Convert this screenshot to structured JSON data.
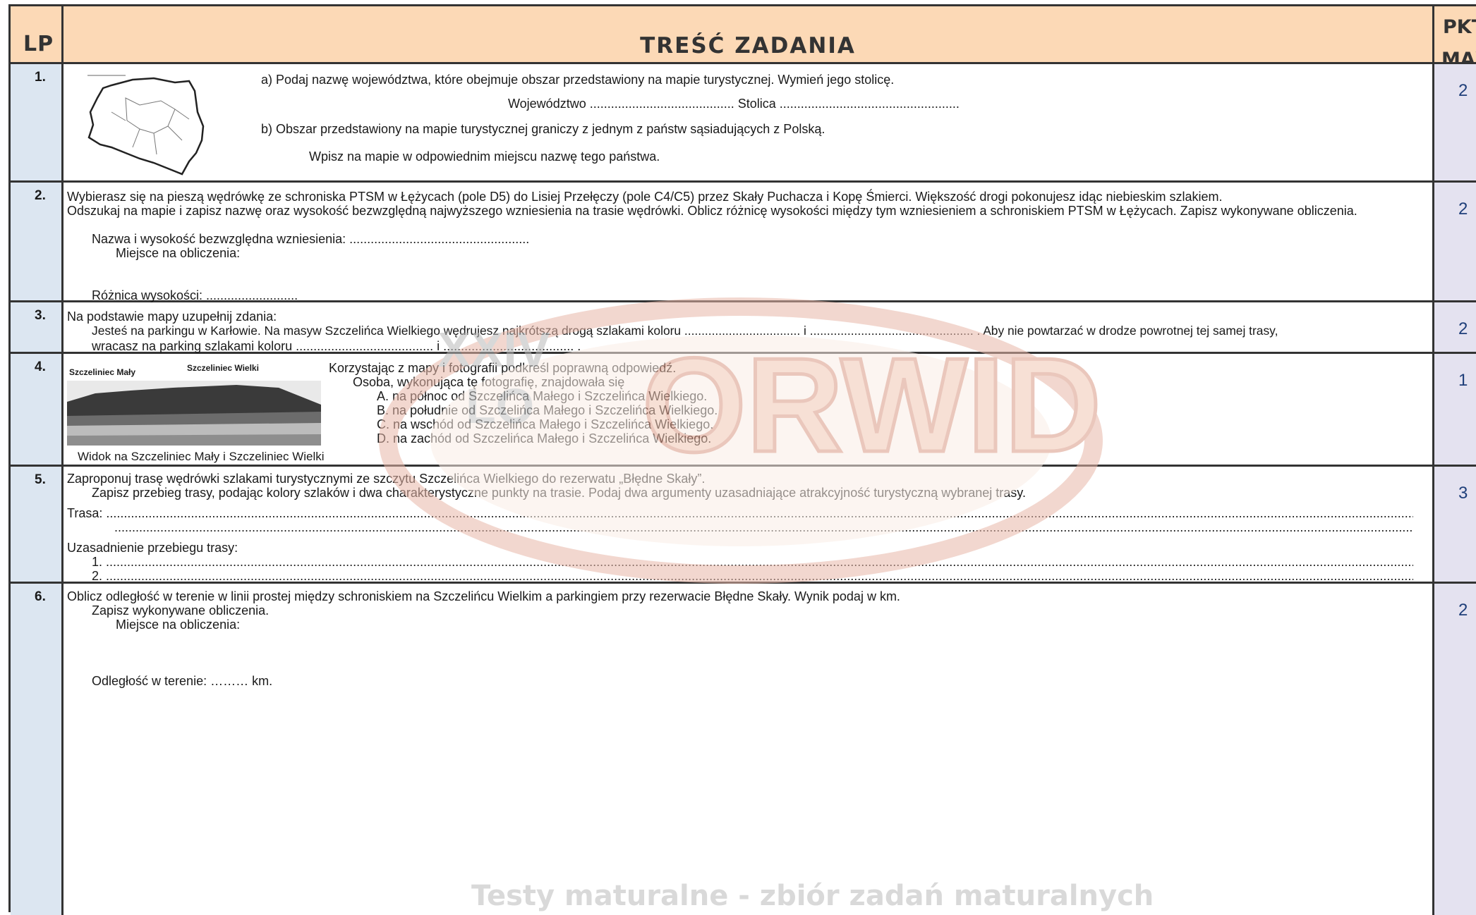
{
  "header": {
    "lp": "LP",
    "content": "TREŚĆ ZADANIA",
    "pkt_line1": "PKT",
    "pkt_line2": "MAX"
  },
  "tasks": [
    {
      "number": "1.",
      "points": "2",
      "lines": [
        "a) Podaj nazwę województwa, które obejmuje obszar przedstawiony na mapie turystycznej. Wymień jego stolicę.",
        "Województwo .........................................   Stolica ...................................................",
        "b) Obszar przedstawiony na mapie turystycznej graniczy z jednym z państw sąsiadujących z Polską.",
        "Wpisz na mapie w odpowiednim miejscu nazwę tego państwa."
      ]
    },
    {
      "number": "2.",
      "points": "2",
      "lines": [
        "Wybierasz się na pieszą wędrówkę ze schroniska PTSM w Łężycach (pole D5) do Lisiej Przełęczy (pole C4/C5) przez Skały Puchacza i Kopę Śmierci. Większość drogi pokonujesz idąc niebieskim szlakiem.",
        "Odszukaj na mapie i zapisz nazwę oraz wysokość bezwzględną najwyższego wzniesienia na trasie wędrówki. Oblicz różnicę wysokości między tym wzniesieniem a schroniskiem PTSM w Łężycach. Zapisz wykonywane obliczenia.",
        "Nazwa i wysokość bezwzględna wzniesienia: ...................................................",
        "Miejsce na obliczenia:",
        "Różnica wysokości: .........................."
      ]
    },
    {
      "number": "3.",
      "points": "2",
      "lines": [
        "Na podstawie mapy uzupełnij zdania:",
        "Jesteś na parkingu w Karłowie. Na masyw Szczelińca Wielkiego wędrujesz najkrótszą drogą szlakami koloru .................................. i ................................................ . Aby nie powtarzać w drodze powrotnej tej samej trasy,",
        "wracasz na parking szlakami koloru ....................................... i ..................................... ."
      ]
    },
    {
      "number": "4.",
      "points": "1",
      "photo_labels": {
        "left": "Szczeliniec Mały",
        "right": "Szczeliniec Wielki"
      },
      "caption": "Widok na Szczeliniec Mały i Szczeliniec Wielki",
      "lines": [
        "Korzystając z mapy i fotografii podkreśl poprawną odpowiedź.",
        "Osoba, wykonująca tę fotografię, znajdowała się"
      ],
      "options": [
        "A. na północ od Szczelińca Małego i Szczelińca Wielkiego.",
        "B. na południe od Szczelińca Małego i Szczelińca Wielkiego.",
        "C. na wschód od Szczelińca Małego i Szczelińca Wielkiego.",
        "D. na zachód od Szczelińca Małego i Szczelińca Wielkiego."
      ]
    },
    {
      "number": "5.",
      "points": "3",
      "lines": [
        "Zaproponuj trasę wędrówki szlakami turystycznymi ze szczytu Szczelińca Wielkiego do rezerwatu „Błędne Skały”.",
        "Zapisz przebieg trasy, podając kolory szlaków i dwa charakterystyczne punkty na trasie. Podaj dwa argumenty uzasadniające atrakcyjność turystyczną wybranej trasy.",
        "Trasa: ......................................................................................................................................................................................................................................................................................................................................................................................................",
        "..................................................................................................................................................................................................................................................................................................................................................................................................",
        "Uzasadnienie przebiegu trasy:",
        "1. ...........................................................................................................................................................................................................................................................................................................................................................................................................",
        "2. ..........................................................................................................................................................................................................................................................................................................................................................................................................."
      ]
    },
    {
      "number": "6.",
      "points": "2",
      "lines": [
        "Oblicz odległość w terenie w linii prostej między schroniskiem na Szczelińcu Wielkim a parkingiem przy rezerwacie Błędne Skały. Wynik podaj w km.",
        "Zapisz wykonywane obliczenia.",
        "Miejsce na obliczenia:",
        "Odległość w terenie: ……… km."
      ]
    }
  ],
  "watermark": {
    "text1": "XXIV",
    "text2": "LO",
    "brand": "ORWID"
  },
  "footer_mark": "Testy maturalne - zbiór zadań maturalnych"
}
